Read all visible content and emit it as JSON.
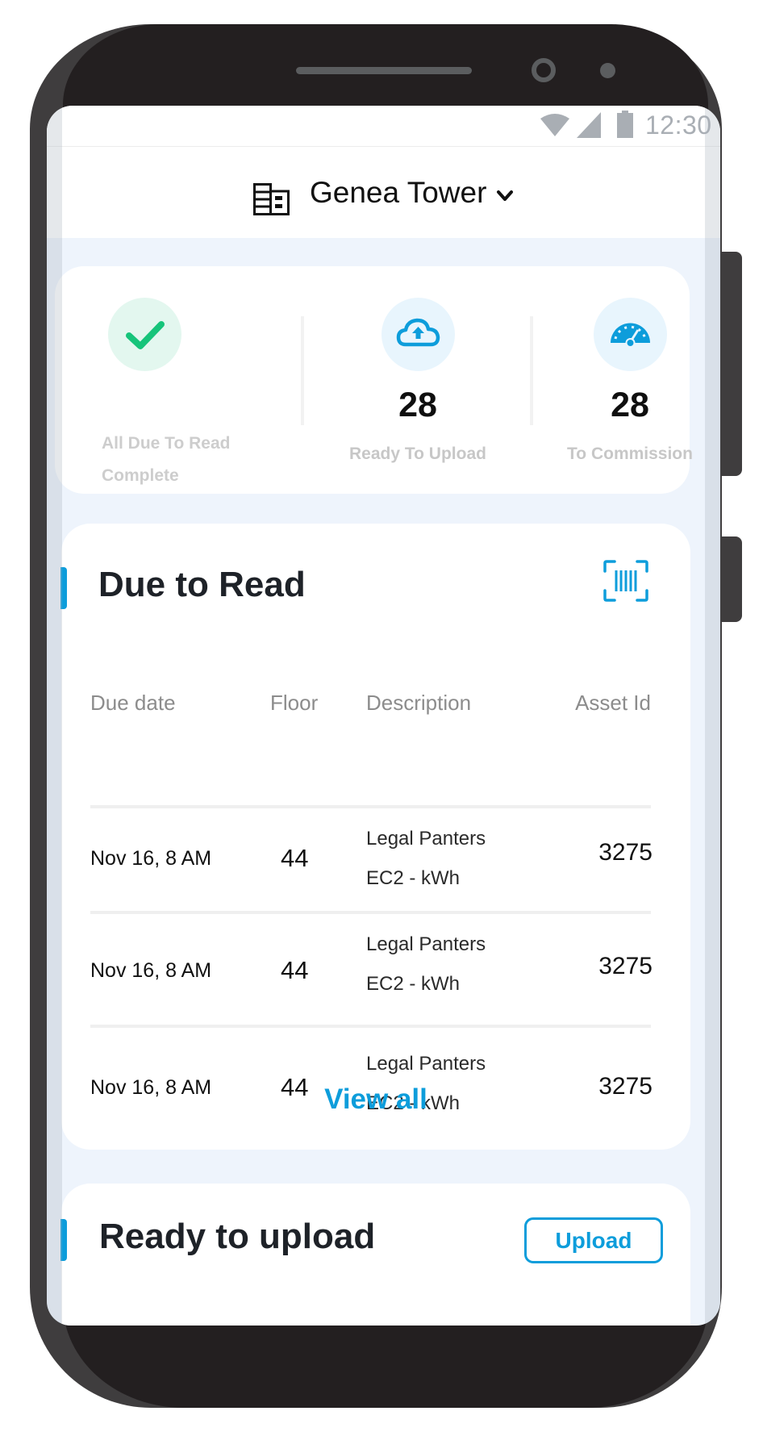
{
  "status_bar": {
    "time": "12:30",
    "icons": [
      "wifi-icon",
      "signal-icon",
      "battery-icon"
    ]
  },
  "header": {
    "icon": "building-icon",
    "site_name": "Genea Tower",
    "dropdown_icon": "chevron-down-icon"
  },
  "summary": {
    "items": [
      {
        "icon": "checkmark-icon",
        "label": "All Due To Read Complete",
        "label_line1": "All Due To Read",
        "label_line2": "Complete",
        "accent": "#16c47a",
        "circle_bg": "#e3f7ef"
      },
      {
        "icon": "cloud-upload-icon",
        "count": "28",
        "label": "Ready To Upload",
        "accent": "#0d9ddb",
        "circle_bg": "#e8f5fd"
      },
      {
        "icon": "speedometer-icon",
        "count": "28",
        "label": "To Commission",
        "accent": "#0d9ddb",
        "circle_bg": "#e8f5fd"
      }
    ]
  },
  "due_to_read": {
    "title": "Due to Read",
    "scan_icon": "barcode-scan-icon",
    "columns": [
      "Due date",
      "Floor",
      "Description",
      "Asset Id"
    ],
    "rows": [
      {
        "due_date": "Nov 16, 8 AM",
        "floor": "44",
        "description_line1": "Legal Panters",
        "description_line2": "EC2 - kWh",
        "asset_id": "3275"
      },
      {
        "due_date": "Nov 16, 8 AM",
        "floor": "44",
        "description_line1": "Legal Panters",
        "description_line2": "EC2 - kWh",
        "asset_id": "3275"
      },
      {
        "due_date": "Nov 16, 8 AM",
        "floor": "44",
        "description_line1": "Legal Panters",
        "description_line2": "EC2 - kWh",
        "asset_id": "3275"
      }
    ],
    "view_all_label": "View all"
  },
  "ready_to_upload": {
    "title": "Ready to upload",
    "upload_button_label": "Upload"
  },
  "colors": {
    "accent_blue": "#0d9ddb",
    "success_green": "#16c47a",
    "page_background": "#eef4fc",
    "frame": "#3f3d3e"
  }
}
